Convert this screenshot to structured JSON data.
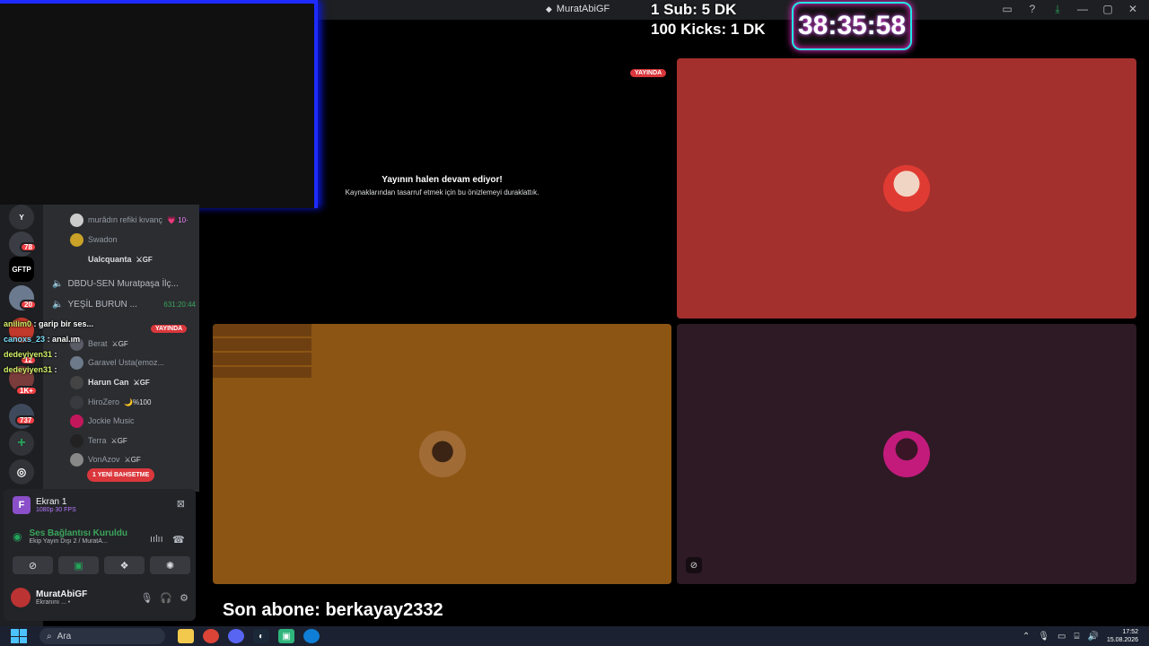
{
  "window": {
    "title": "MuratAbiGF",
    "controls": [
      "inbox-icon",
      "help-icon",
      "download-icon",
      "minimize-icon",
      "maximize-icon",
      "close-icon"
    ]
  },
  "overlay": {
    "sub_line": "1 Sub: 5 DK",
    "kick_line": "100 Kicks: 1 DK",
    "timer": "38:35:58",
    "last_sub": "Son abone: berkayay2332",
    "colors": {
      "timer_border": "#21e6e6",
      "timer_glow": "#ff2bd6",
      "cam_border": "#1d2bff"
    }
  },
  "servers": [
    {
      "label": "Y",
      "badge": ""
    },
    {
      "label": "",
      "badge": "78"
    },
    {
      "label": "GFTP",
      "badge": ""
    },
    {
      "label": "",
      "badge": "20"
    },
    {
      "label": "",
      "badge": "12"
    },
    {
      "label": "",
      "badge": "1K+"
    },
    {
      "label": "",
      "badge": "737"
    }
  ],
  "members": [
    {
      "name": "murâdın refiki kıvanç",
      "tag": "💗 10·",
      "bold": false
    },
    {
      "name": "Swadon",
      "tag": "",
      "bold": false
    },
    {
      "name": "Ualcquanta",
      "tag": "⚔GF",
      "bold": true
    }
  ],
  "voice_channels": [
    {
      "name": "DBDU-SEN Muratpaşa İlç...",
      "time": ""
    },
    {
      "name": "YEŞİL BURUN ...",
      "time": "631:20:44"
    }
  ],
  "members2": [
    {
      "name": "Berat",
      "tag": "⚔GF",
      "bold": false
    },
    {
      "name": "Garavel Usta(emoz...",
      "tag": "",
      "bold": false
    },
    {
      "name": "Harun Can",
      "tag": "⚔GF",
      "bold": true
    },
    {
      "name": "HiroZero",
      "tag": "🌙%100",
      "bold": false
    },
    {
      "name": "Jockie Music",
      "tag": "",
      "bold": false
    },
    {
      "name": "Terra",
      "tag": "⚔GF",
      "bold": false
    },
    {
      "name": "VonAzov",
      "tag": "⚔GF",
      "bold": false
    }
  ],
  "live_pill": "YAYINDA",
  "unread_pill": "1 YENİ BAHSETME",
  "chat": [
    {
      "user": "anilim0",
      "text": ": garip bir ses...",
      "color": "yellow"
    },
    {
      "user": "canoxs_23",
      "text": ": anal.ım",
      "color": "blue"
    },
    {
      "user": "dedeyiyen31",
      "text": ":",
      "color": "yellow"
    },
    {
      "user": "dedeyiyen31",
      "text": ":",
      "color": "yellow"
    }
  ],
  "screen_share": {
    "letter": "F",
    "title": "Ekran 1",
    "sub": "1080p 30 FPS"
  },
  "voice_connection": {
    "title": "Ses Bağlantısı Kuruldu",
    "sub": "Ekip Yayın Dışı 2 / MuratA..."
  },
  "account": {
    "name": "MuratAbiGF",
    "status": "Ekranını ... •"
  },
  "stream": {
    "live_label": "YAYINDA",
    "paused_title": "Yayının halen devam ediyor!",
    "paused_sub": "Kaynaklarından tasarruf etmek için bu önizlemeyi duraklattık."
  },
  "taskbar": {
    "search_placeholder": "Ara",
    "time": "17:52",
    "date": "15.08.2026"
  }
}
